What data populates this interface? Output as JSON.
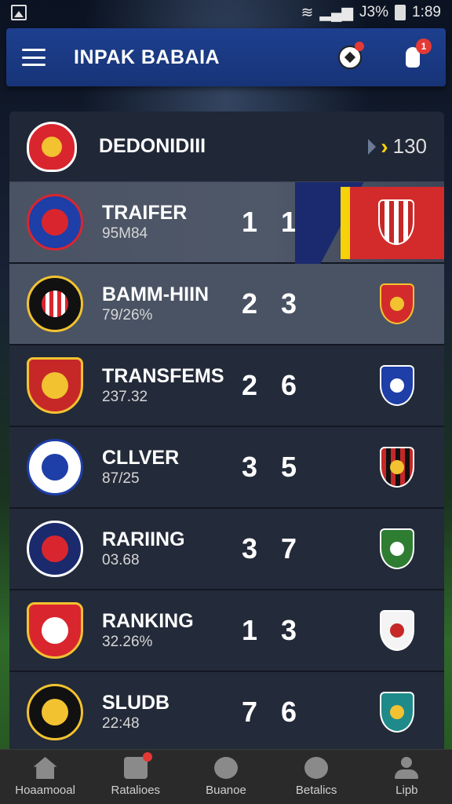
{
  "status_bar": {
    "battery": "J3%",
    "time": "1:89"
  },
  "app_bar": {
    "title": "INPAK BABAIA",
    "notification_count": "1"
  },
  "header": {
    "title": "DEDONIDIII",
    "value": "130"
  },
  "rows": [
    {
      "name": "TRAIFER",
      "sub": "95M84",
      "score": "1 1",
      "right_crest": "ac-milan-style-crest"
    },
    {
      "name": "BAMM-HIIN",
      "sub": "79/26%",
      "score": "2 3",
      "right_crest": "red-yellow-crest"
    },
    {
      "name": "TRANSFEMS",
      "sub": "237.32",
      "score": "2 6",
      "right_crest": "blue-crest"
    },
    {
      "name": "CLLVER",
      "sub": "87/25",
      "score": "3 5",
      "right_crest": "red-black-star-crest"
    },
    {
      "name": "RARIING",
      "sub": "03.68",
      "score": "3 7",
      "right_crest": "green-ball-crest"
    },
    {
      "name": "RANKING",
      "sub": "32.26%",
      "score": "1 3",
      "right_crest": "white-red-crest"
    },
    {
      "name": "SLUDB",
      "sub": "22:48",
      "score": "7 6",
      "right_crest": "teal-crest"
    }
  ],
  "bottom_nav": [
    {
      "label": "Hoaamooal",
      "icon": "home-icon"
    },
    {
      "label": "Ratalioes",
      "icon": "document-icon"
    },
    {
      "label": "Buanoe",
      "icon": "football-icon"
    },
    {
      "label": "Betalics",
      "icon": "face-icon"
    },
    {
      "label": "Lipb",
      "icon": "user-icon"
    }
  ],
  "colors": {
    "app_bar": "#1d3f8e",
    "accent_yellow": "#f5d20a",
    "badge_red": "#e53935"
  }
}
